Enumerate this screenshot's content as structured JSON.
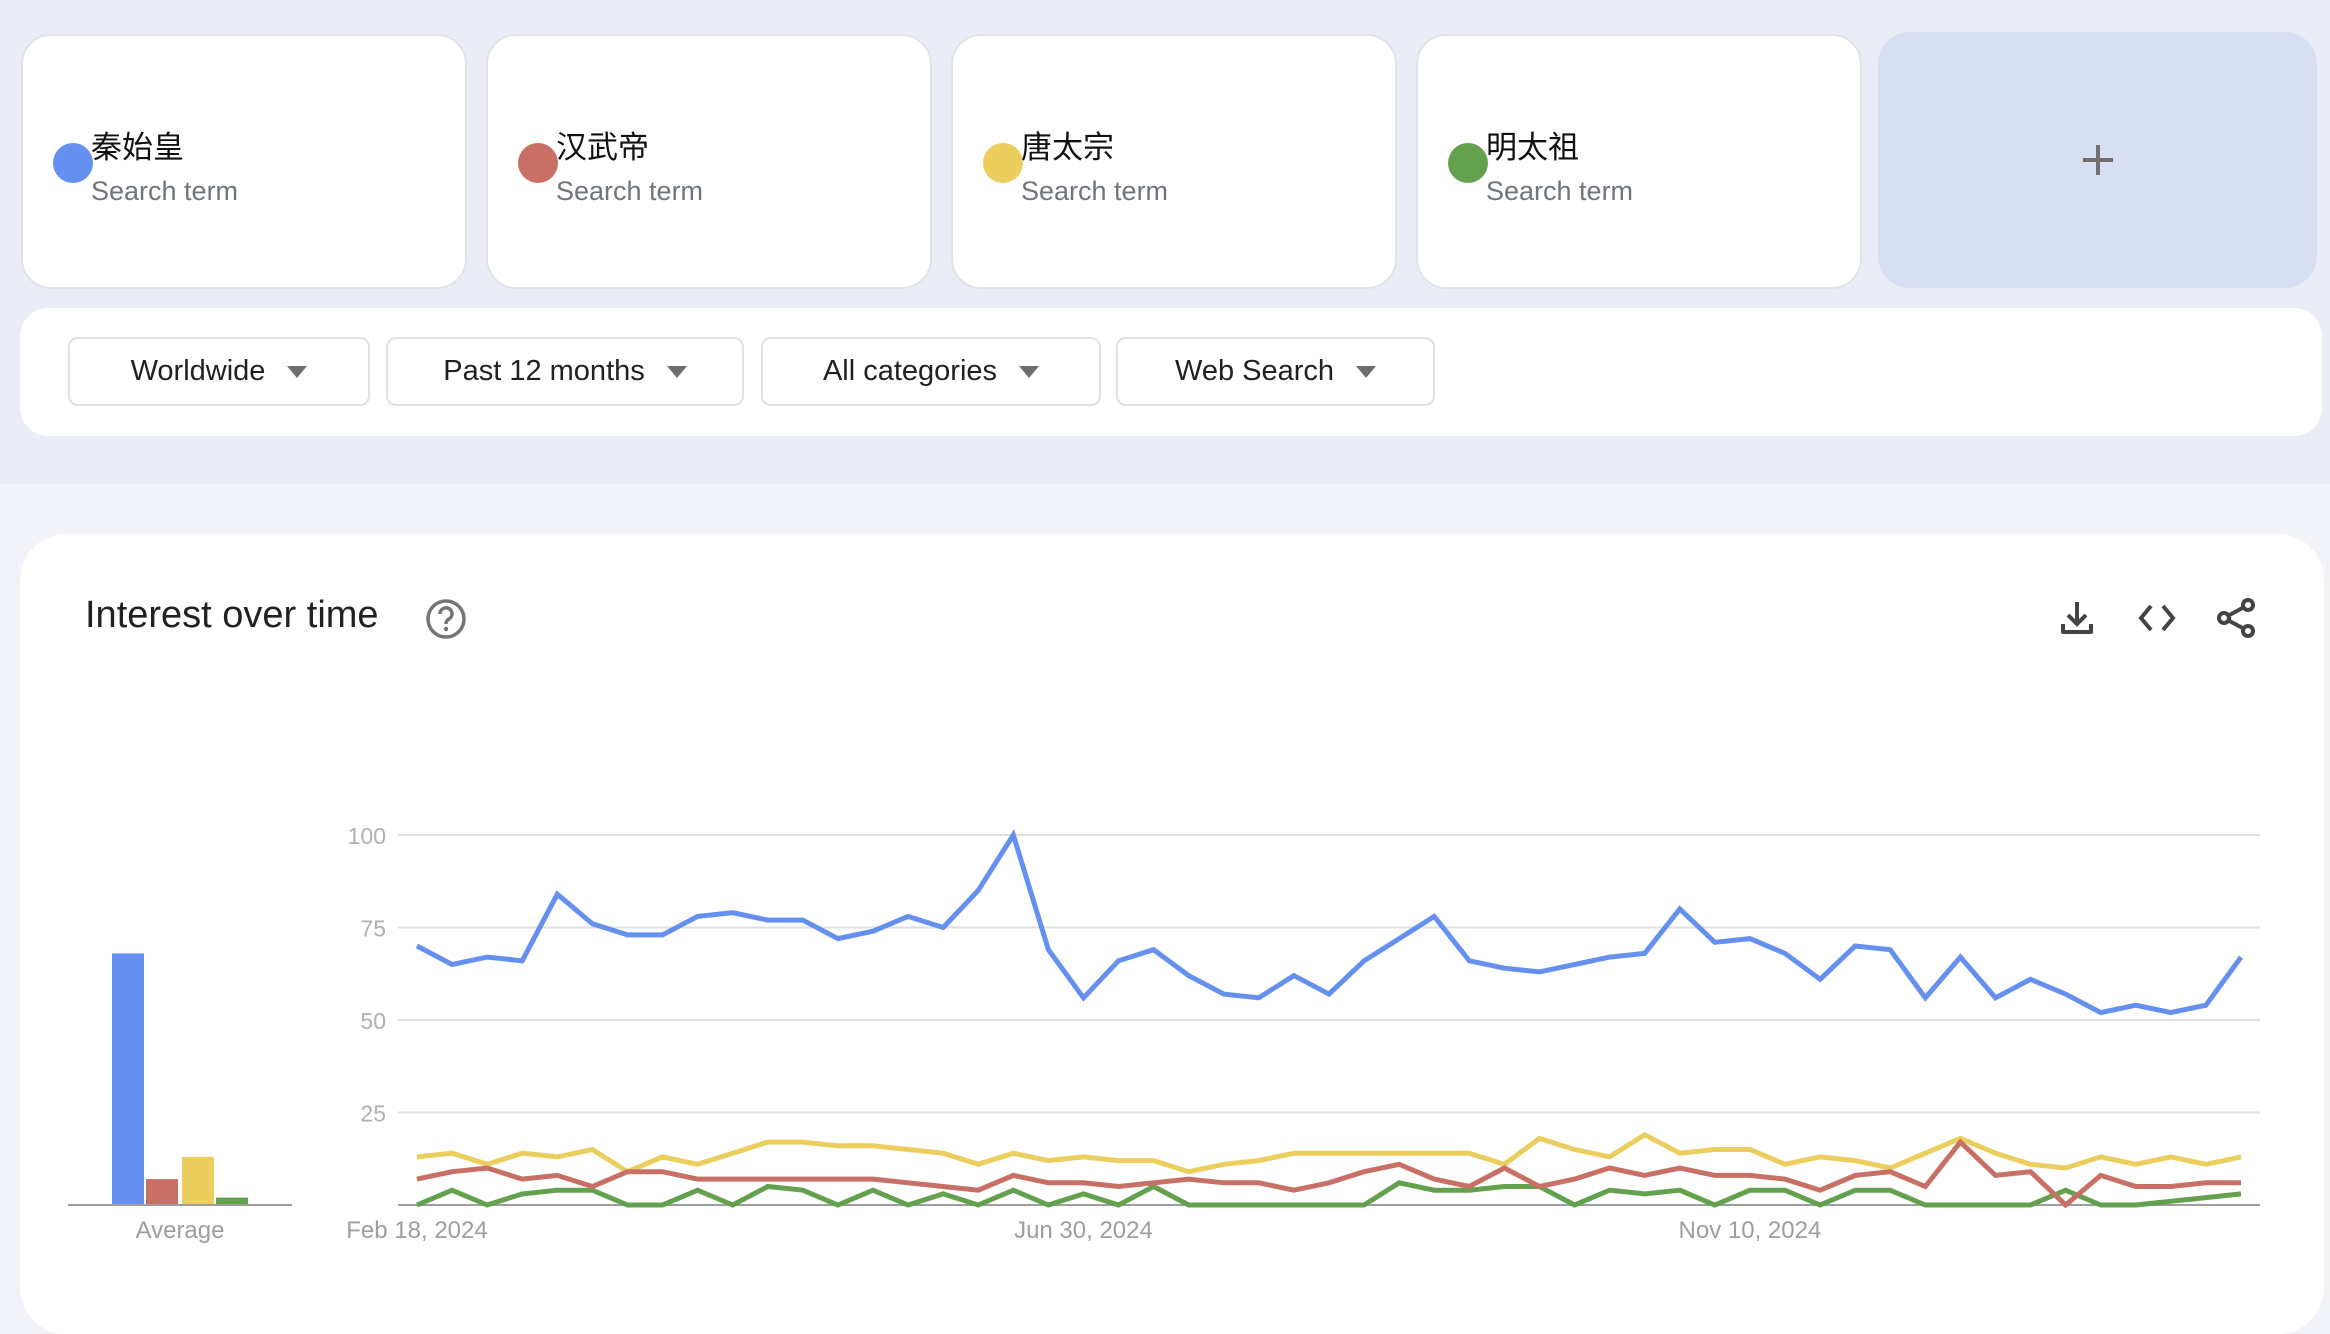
{
  "terms": [
    {
      "name": "秦始皇",
      "subtitle": "Search term",
      "color": "#6690f0"
    },
    {
      "name": "汉武帝",
      "subtitle": "Search term",
      "color": "#c87065"
    },
    {
      "name": "唐太宗",
      "subtitle": "Search term",
      "color": "#ecce5e"
    },
    {
      "name": "明太祖",
      "subtitle": "Search term",
      "color": "#64a14f"
    }
  ],
  "add_term": {
    "icon": "plus-icon"
  },
  "filters": [
    {
      "label": "Worldwide"
    },
    {
      "label": "Past 12 months"
    },
    {
      "label": "All categories"
    },
    {
      "label": "Web Search"
    }
  ],
  "panel": {
    "title": "Interest over time",
    "help_icon": "help-circle-icon",
    "actions": [
      "download-icon",
      "embed-code-icon",
      "share-icon"
    ]
  },
  "chart_data": {
    "type": "line",
    "title": "Interest over time",
    "xlabel": "",
    "ylabel": "",
    "ylim": [
      0,
      100
    ],
    "yticks": [
      25,
      50,
      75,
      100
    ],
    "grid": true,
    "x_tick_labels": [
      {
        "index": 0,
        "label": "Feb 18, 2024"
      },
      {
        "index": 19,
        "label": "Jun 30, 2024"
      },
      {
        "index": 38,
        "label": "Nov 10, 2024"
      }
    ],
    "x_start": "Feb 18, 2024",
    "x_interval": "weekly",
    "num_points": 53,
    "series": [
      {
        "name": "秦始皇",
        "color": "#6690f0",
        "values": [
          70,
          65,
          67,
          66,
          84,
          76,
          73,
          73,
          78,
          79,
          77,
          77,
          72,
          74,
          78,
          75,
          85,
          100,
          69,
          56,
          66,
          69,
          62,
          57,
          56,
          62,
          57,
          66,
          72,
          78,
          66,
          64,
          63,
          65,
          67,
          68,
          80,
          71,
          72,
          68,
          61,
          70,
          69,
          56,
          67,
          56,
          61,
          57,
          52,
          54,
          52,
          54,
          67
        ]
      },
      {
        "name": "汉武帝",
        "color": "#c87065",
        "values": [
          7,
          9,
          10,
          7,
          8,
          5,
          9,
          9,
          7,
          7,
          7,
          7,
          7,
          7,
          6,
          5,
          4,
          8,
          6,
          6,
          5,
          6,
          7,
          6,
          6,
          4,
          6,
          9,
          11,
          7,
          5,
          10,
          5,
          7,
          10,
          8,
          10,
          8,
          8,
          7,
          4,
          8,
          9,
          5,
          17,
          8,
          9,
          0,
          8,
          5,
          5,
          6,
          6
        ]
      },
      {
        "name": "唐太宗",
        "color": "#ecce5e",
        "values": [
          13,
          14,
          11,
          14,
          13,
          15,
          9,
          13,
          11,
          14,
          17,
          17,
          16,
          16,
          15,
          14,
          11,
          14,
          12,
          13,
          12,
          12,
          9,
          11,
          12,
          14,
          14,
          14,
          14,
          14,
          14,
          11,
          18,
          15,
          13,
          19,
          14,
          15,
          15,
          11,
          13,
          12,
          10,
          14,
          18,
          14,
          11,
          10,
          13,
          11,
          13,
          11,
          13
        ]
      },
      {
        "name": "明太祖",
        "color": "#64a14f",
        "values": [
          0,
          4,
          0,
          3,
          4,
          4,
          0,
          0,
          4,
          0,
          5,
          4,
          0,
          4,
          0,
          3,
          0,
          4,
          0,
          3,
          0,
          5,
          0,
          0,
          0,
          0,
          0,
          0,
          6,
          4,
          4,
          5,
          5,
          0,
          4,
          3,
          4,
          0,
          4,
          4,
          0,
          4,
          4,
          0,
          0,
          0,
          0,
          4,
          0,
          0,
          1,
          2,
          3
        ]
      }
    ],
    "averages": {
      "label": "Average",
      "values": [
        68,
        7,
        13,
        2
      ]
    }
  }
}
